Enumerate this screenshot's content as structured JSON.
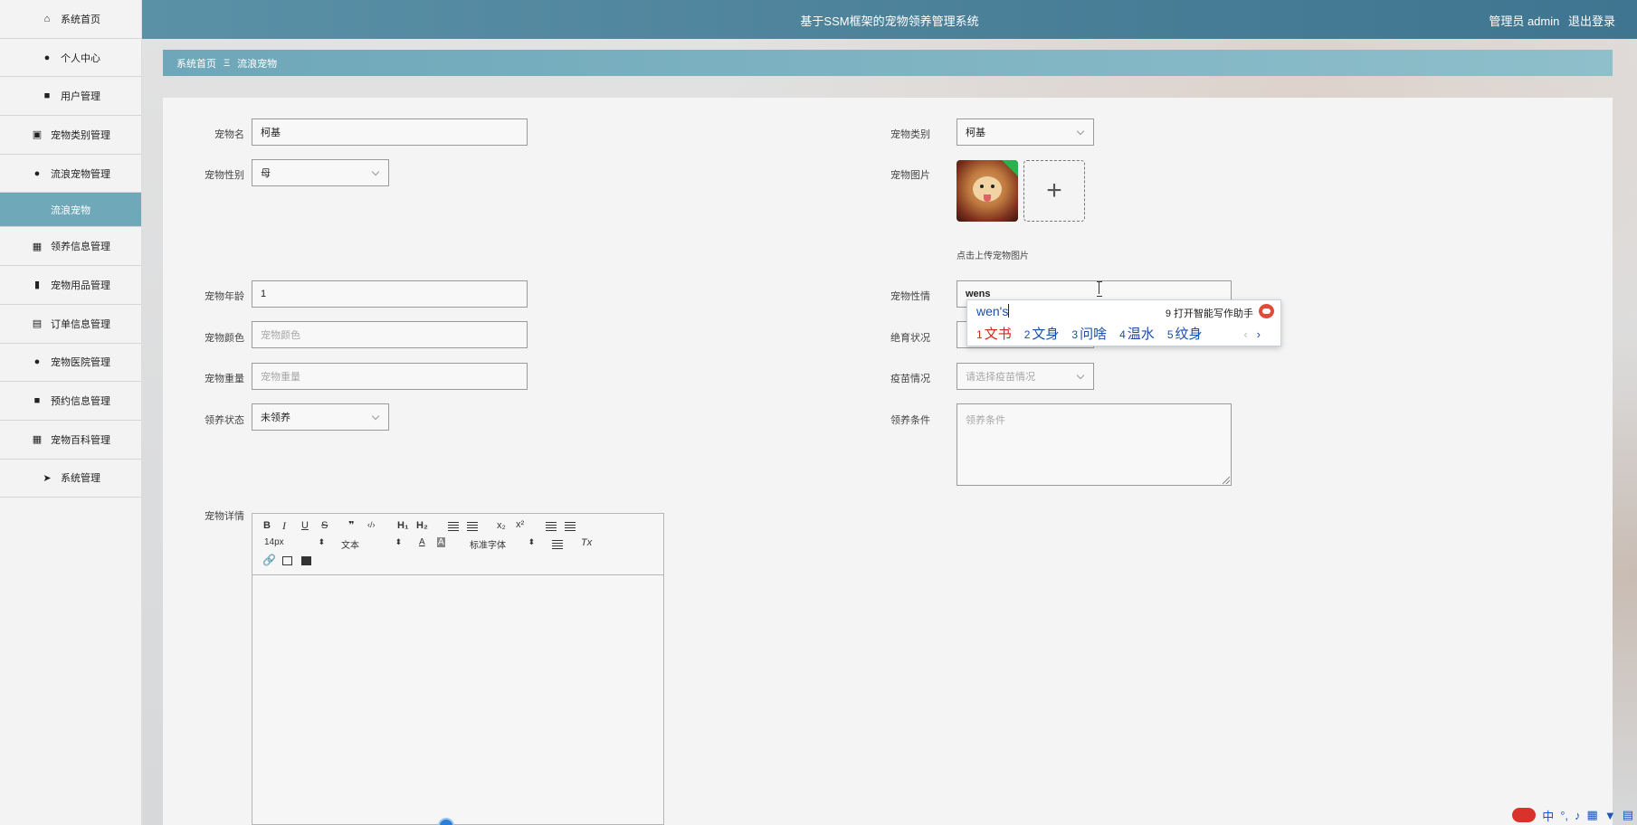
{
  "header": {
    "title": "基于SSM框架的宠物领养管理系统",
    "user_label": "管理员 admin",
    "logout": "退出登录"
  },
  "sidebar": {
    "items": [
      {
        "label": "系统首页",
        "icon": "home-icon"
      },
      {
        "label": "个人中心",
        "icon": "user-icon"
      },
      {
        "label": "用户管理",
        "icon": "briefcase-icon"
      },
      {
        "label": "宠物类别管理",
        "icon": "chart-icon"
      },
      {
        "label": "流浪宠物管理",
        "icon": "user-icon"
      },
      {
        "label": "流浪宠物",
        "icon": "",
        "active": true
      },
      {
        "label": "领养信息管理",
        "icon": "grid-icon"
      },
      {
        "label": "宠物用品管理",
        "icon": "bar-chart-icon"
      },
      {
        "label": "订单信息管理",
        "icon": "clipboard-icon"
      },
      {
        "label": "宠物医院管理",
        "icon": "user-icon"
      },
      {
        "label": "预约信息管理",
        "icon": "briefcase-icon"
      },
      {
        "label": "宠物百科管理",
        "icon": "grid-icon"
      },
      {
        "label": "系统管理",
        "icon": "send-icon"
      }
    ]
  },
  "breadcrumb": {
    "home": "系统首页",
    "sep": "Ξ",
    "current": "流浪宠物"
  },
  "form": {
    "name_label": "宠物名",
    "name_value": "柯基",
    "category_label": "宠物类别",
    "category_value": "柯基",
    "gender_label": "宠物性别",
    "gender_value": "母",
    "image_label": "宠物图片",
    "upload_hint": "点击上传宠物图片",
    "age_label": "宠物年龄",
    "age_value": "1",
    "temper_label": "宠物性情",
    "temper_value": "wens",
    "color_label": "宠物颜色",
    "color_placeholder": "宠物颜色",
    "sterile_label": "绝育状况",
    "weight_label": "宠物重量",
    "weight_placeholder": "宠物重量",
    "vaccine_label": "疫苗情况",
    "vaccine_placeholder": "请选择疫苗情况",
    "adopt_status_label": "领养状态",
    "adopt_status_value": "未领养",
    "condition_label": "领养条件",
    "condition_placeholder": "领养条件",
    "detail_label": "宠物详情"
  },
  "editor": {
    "font_size": "14px",
    "block_type": "文本",
    "font_family": "标准字体",
    "h1": "H₁",
    "h2": "H₂",
    "sub": "x₂",
    "sup": "x²",
    "bold": "B",
    "italic": "I",
    "underline": "U",
    "strike": "S",
    "quote": "❞",
    "code": "‹/›",
    "clear": "Tx"
  },
  "ime": {
    "composition": "wen's",
    "assist": "9 打开智能写作助手",
    "candidates": [
      {
        "n": "1",
        "text": "文书"
      },
      {
        "n": "2",
        "text": "文身"
      },
      {
        "n": "3",
        "text": "问啥"
      },
      {
        "n": "4",
        "text": "温水"
      },
      {
        "n": "5",
        "text": "纹身"
      }
    ],
    "prev": "‹",
    "next": "›"
  },
  "tray": {
    "ime_mode": "中",
    "punct": "°,"
  }
}
